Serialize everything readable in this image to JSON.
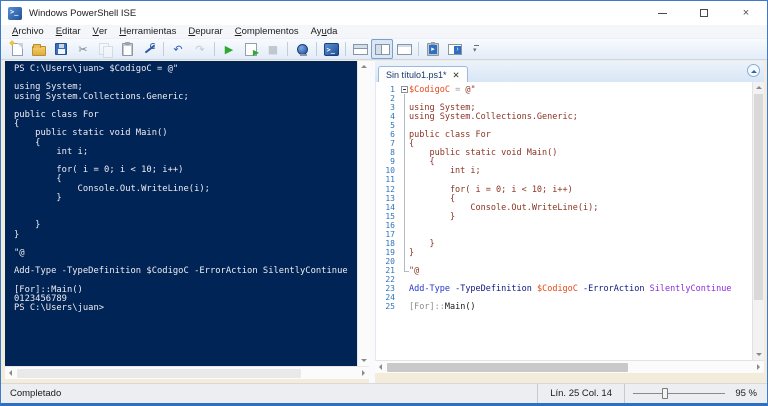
{
  "colors": {
    "console-bg": "#012456",
    "console-fg": "#EFEDF0",
    "tok-var": "#E64A19",
    "tok-str": "#8B3222",
    "tok-cmd": "#2435CC",
    "tok-par": "#101680",
    "tok-arg": "#8A2BE2",
    "tok-op": "#9A9A9A",
    "tok-typ": "#8C8C8C",
    "tok-mem": "#1A1A1A",
    "tok-lnum": "#2F74BC",
    "accent": "#2E6FC0"
  },
  "window": {
    "title": "Windows PowerShell ISE"
  },
  "titlebar": {
    "buttons": [
      {
        "name": "minimize",
        "kind": "min"
      },
      {
        "name": "maximize",
        "kind": "max"
      },
      {
        "name": "close",
        "kind": "close",
        "glyph": "×"
      }
    ]
  },
  "menu": {
    "items": [
      {
        "name": "archivo",
        "label": "Archivo",
        "u": 0
      },
      {
        "name": "editar",
        "label": "Editar",
        "u": 0
      },
      {
        "name": "ver",
        "label": "Ver",
        "u": 0
      },
      {
        "name": "herramientas",
        "label": "Herramientas",
        "u": 0
      },
      {
        "name": "depurar",
        "label": "Depurar",
        "u": 0
      },
      {
        "name": "complementos",
        "label": "Complementos",
        "u": 0
      },
      {
        "name": "ayuda",
        "label": "Ayuda",
        "u": 2
      }
    ]
  },
  "toolbar": {
    "buttons": [
      {
        "name": "new-script",
        "kind": "page"
      },
      {
        "name": "open-script",
        "kind": "folder"
      },
      {
        "name": "save-script",
        "kind": "floppy"
      },
      {
        "name": "cut",
        "kind": "glyph",
        "glyph": "✂",
        "color": "#6E7E92"
      },
      {
        "name": "copy",
        "kind": "copy",
        "disabled": true
      },
      {
        "name": "paste",
        "kind": "clipboard"
      },
      {
        "name": "clear-console-pane",
        "kind": "wrench"
      },
      {
        "sep": true
      },
      {
        "name": "undo",
        "kind": "glyph",
        "glyph": "↶",
        "color": "#2E5FB8"
      },
      {
        "name": "redo",
        "kind": "glyph",
        "glyph": "↷",
        "color": "#8A94A0",
        "disabled": true
      },
      {
        "sep": true
      },
      {
        "name": "run-script",
        "kind": "glyph",
        "glyph": "▶",
        "color": "#2FA832"
      },
      {
        "name": "run-selection",
        "kind": "runsel"
      },
      {
        "name": "stop-operation",
        "kind": "glyph",
        "glyph": "■",
        "color": "#8F959B",
        "disabled": true
      },
      {
        "sep": true
      },
      {
        "name": "new-remote-powershell-tab",
        "kind": "remote"
      },
      {
        "sep": true
      },
      {
        "name": "start-powershell-exe",
        "kind": "ps"
      },
      {
        "sep": true
      },
      {
        "name": "show-script-pane-top",
        "kind": "layout-top"
      },
      {
        "name": "show-script-pane-right",
        "kind": "layout-right",
        "selected": true
      },
      {
        "name": "show-script-pane-maximized",
        "kind": "layout-max"
      },
      {
        "sep": true
      },
      {
        "name": "show-script-pane",
        "kind": "clip-ps"
      },
      {
        "name": "show-console-pane",
        "kind": "win-ps"
      },
      {
        "name": "toolbar-overflow",
        "kind": "overflow"
      }
    ]
  },
  "console": {
    "lines": [
      "PS C:\\Users\\juan> $CodigoC = @\"",
      "",
      "using System;",
      "using System.Collections.Generic;",
      "",
      "public class For",
      "{",
      "    public static void Main()",
      "    {",
      "        int i;",
      "",
      "        for( i = 0; i < 10; i++)",
      "        {",
      "            Console.Out.WriteLine(i);",
      "        }",
      "",
      "",
      "    }",
      "}",
      "",
      "\"@",
      "",
      "Add-Type -TypeDefinition $CodigoC -ErrorAction SilentlyContinue",
      "",
      "[For]::Main()",
      "0123456789",
      "PS C:\\Users\\juan>"
    ]
  },
  "editor": {
    "tab": {
      "label": "Sin título1.ps1*",
      "close_glyph": "✕"
    },
    "lines": [
      {
        "n": 1,
        "segs": [
          [
            "$CodigoC",
            "v"
          ],
          [
            " ",
            "d"
          ],
          [
            "=",
            "o"
          ],
          [
            " ",
            "d"
          ],
          [
            "@\"",
            "s"
          ]
        ]
      },
      {
        "n": 2,
        "segs": []
      },
      {
        "n": 3,
        "segs": [
          [
            "using System;",
            "s"
          ]
        ]
      },
      {
        "n": 4,
        "segs": [
          [
            "using System.Collections.Generic;",
            "s"
          ]
        ]
      },
      {
        "n": 5,
        "segs": []
      },
      {
        "n": 6,
        "segs": [
          [
            "public class For",
            "s"
          ]
        ]
      },
      {
        "n": 7,
        "segs": [
          [
            "{",
            "s"
          ]
        ]
      },
      {
        "n": 8,
        "segs": [
          [
            "    public static void Main()",
            "s"
          ]
        ]
      },
      {
        "n": 9,
        "segs": [
          [
            "    {",
            "s"
          ]
        ]
      },
      {
        "n": 10,
        "segs": [
          [
            "        int i;",
            "s"
          ]
        ]
      },
      {
        "n": 11,
        "segs": []
      },
      {
        "n": 12,
        "segs": [
          [
            "        for( i = 0; i < 10; i++)",
            "s"
          ]
        ]
      },
      {
        "n": 13,
        "segs": [
          [
            "        {",
            "s"
          ]
        ]
      },
      {
        "n": 14,
        "segs": [
          [
            "            Console.Out.WriteLine(i);",
            "s"
          ]
        ]
      },
      {
        "n": 15,
        "segs": [
          [
            "        }",
            "s"
          ]
        ]
      },
      {
        "n": 16,
        "segs": []
      },
      {
        "n": 17,
        "segs": []
      },
      {
        "n": 18,
        "segs": [
          [
            "    }",
            "s"
          ]
        ]
      },
      {
        "n": 19,
        "segs": [
          [
            "}",
            "s"
          ]
        ]
      },
      {
        "n": 20,
        "segs": []
      },
      {
        "n": 21,
        "segs": [
          [
            "\"@",
            "s"
          ]
        ]
      },
      {
        "n": 22,
        "segs": []
      },
      {
        "n": 23,
        "segs": [
          [
            "Add-Type",
            "c"
          ],
          [
            " ",
            "d"
          ],
          [
            "-TypeDefinition",
            "p"
          ],
          [
            " ",
            "d"
          ],
          [
            "$CodigoC",
            "v"
          ],
          [
            " ",
            "d"
          ],
          [
            "-ErrorAction",
            "p"
          ],
          [
            " ",
            "d"
          ],
          [
            "SilentlyContinue",
            "a"
          ]
        ]
      },
      {
        "n": 24,
        "segs": []
      },
      {
        "n": 25,
        "segs": [
          [
            "[For]",
            "t"
          ],
          [
            "::",
            "o"
          ],
          [
            "Main()",
            "m"
          ]
        ]
      }
    ]
  },
  "statusbar": {
    "status": "Completado",
    "line_col": "Lín. 25 Col. 14",
    "zoom": "95 %"
  }
}
